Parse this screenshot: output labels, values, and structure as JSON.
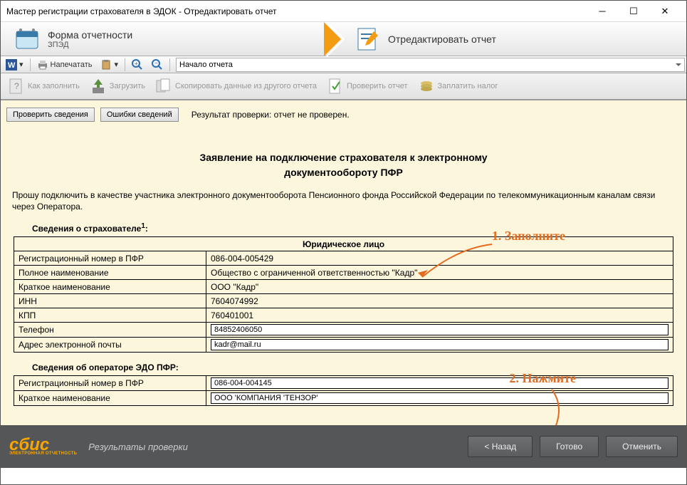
{
  "window": {
    "title": "Мастер регистрации страхователя в ЭДОК - Отредактировать отчет"
  },
  "steps": {
    "s1_title": "Форма отчетности",
    "s1_sub": "ЗПЭД",
    "s2_title": "Отредактировать отчет"
  },
  "toolbar1": {
    "print": "Напечатать",
    "navStart": "Начало отчета"
  },
  "toolbar2": {
    "howto": "Как заполнить",
    "load": "Загрузить",
    "copy": "Скопировать данные из другого отчета",
    "check": "Проверить отчет",
    "pay": "Заплатить налог"
  },
  "buttons": {
    "checkData": "Проверить сведения",
    "errors": "Ошибки сведений"
  },
  "checkResult": "Результат проверки: отчет не проверен.",
  "doc": {
    "titleLine1": "Заявление на подключение страхователя к электронному",
    "titleLine2": "документообороту ПФР",
    "intro": "Прошу подключить в качестве участника электронного документооборота Пенсионного фонда Российской Федерации по телекоммуникационным каналам связи через Оператора.",
    "section1": "Сведения о страхователе",
    "sectionSup": "1",
    "sectionColon": ":",
    "legalHeader": "Юридическое лицо",
    "rows1": {
      "regNum": {
        "label": "Регистрационный номер в ПФР",
        "value": "086-004-005429"
      },
      "fullName": {
        "label": "Полное наименование",
        "value": "Общество с ограниченной ответственностью \"Кадр\""
      },
      "shortName": {
        "label": "Краткое наименование",
        "value": "ООО \"Кадр\""
      },
      "inn": {
        "label": "ИНН",
        "value": "7604074992"
      },
      "kpp": {
        "label": "КПП",
        "value": "760401001"
      },
      "phone": {
        "label": "Телефон",
        "value": "84852406050"
      },
      "email": {
        "label": "Адрес электронной почты",
        "value": "kadr@mail.ru"
      }
    },
    "section2": "Сведения об операторе ЭДО ПФР:",
    "rows2": {
      "regNum": {
        "label": "Регистрационный номер в ПФР",
        "value": "086-004-004145"
      },
      "shortName": {
        "label": "Краткое наименование",
        "value": "ООО 'КОМПАНИЯ 'ТЕНЗОР'"
      }
    }
  },
  "annotations": {
    "a1": "1. Заполните",
    "a2": "2. Нажмите"
  },
  "footer": {
    "logo": "сбис",
    "logoSub": "ЭЛЕКТРОННАЯ ОТЧЕТНОСТЬ",
    "results": "Результаты проверки",
    "back": "< Назад",
    "done": "Готово",
    "cancel": "Отменить"
  }
}
